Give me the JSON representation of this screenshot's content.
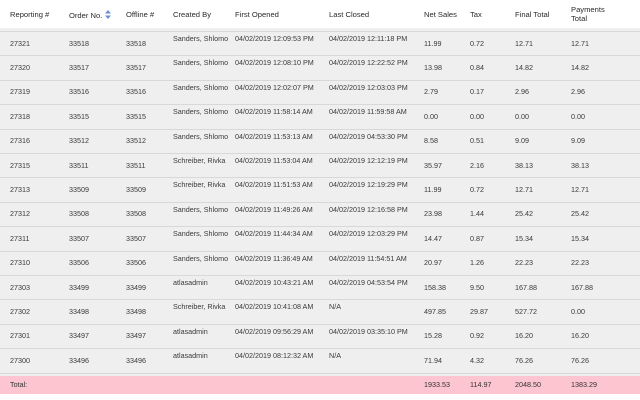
{
  "columns": [
    {
      "key": "rep",
      "label": "Reporting #"
    },
    {
      "key": "order",
      "label": "Order No."
    },
    {
      "key": "offline",
      "label": "Offline #"
    },
    {
      "key": "created",
      "label": "Created By"
    },
    {
      "key": "first",
      "label": "First Opened"
    },
    {
      "key": "last",
      "label": "Last Closed"
    },
    {
      "key": "net",
      "label": "Net Sales"
    },
    {
      "key": "tax",
      "label": "Tax"
    },
    {
      "key": "final",
      "label": "Final Total"
    },
    {
      "key": "pay",
      "label": "Payments Total"
    }
  ],
  "sort_icon": "sort-arrows-icon",
  "rows": [
    {
      "rep": "27321",
      "order": "33518",
      "offline": "33518",
      "created": "Sanders, Shlomo",
      "first": "04/02/2019 12:09:53 PM",
      "last": "04/02/2019 12:11:18 PM",
      "net": "11.99",
      "tax": "0.72",
      "final": "12.71",
      "pay": "12.71"
    },
    {
      "rep": "27320",
      "order": "33517",
      "offline": "33517",
      "created": "Sanders, Shlomo",
      "first": "04/02/2019 12:08:10 PM",
      "last": "04/02/2019 12:22:52 PM",
      "net": "13.98",
      "tax": "0.84",
      "final": "14.82",
      "pay": "14.82"
    },
    {
      "rep": "27319",
      "order": "33516",
      "offline": "33516",
      "created": "Sanders, Shlomo",
      "first": "04/02/2019 12:02:07 PM",
      "last": "04/02/2019 12:03:03 PM",
      "net": "2.79",
      "tax": "0.17",
      "final": "2.96",
      "pay": "2.96"
    },
    {
      "rep": "27318",
      "order": "33515",
      "offline": "33515",
      "created": "Sanders, Shlomo",
      "first": "04/02/2019 11:58:14 AM",
      "last": "04/02/2019 11:59:58 AM",
      "net": "0.00",
      "tax": "0.00",
      "final": "0.00",
      "pay": "0.00"
    },
    {
      "rep": "27316",
      "order": "33512",
      "offline": "33512",
      "created": "Sanders, Shlomo",
      "first": "04/02/2019 11:53:13 AM",
      "last": "04/02/2019 04:53:30 PM",
      "net": "8.58",
      "tax": "0.51",
      "final": "9.09",
      "pay": "9.09"
    },
    {
      "rep": "27315",
      "order": "33511",
      "offline": "33511",
      "created": "Schreiber, Rivka",
      "first": "04/02/2019 11:53:04 AM",
      "last": "04/02/2019 12:12:19 PM",
      "net": "35.97",
      "tax": "2.16",
      "final": "38.13",
      "pay": "38.13"
    },
    {
      "rep": "27313",
      "order": "33509",
      "offline": "33509",
      "created": "Schreiber, Rivka",
      "first": "04/02/2019 11:51:53 AM",
      "last": "04/02/2019 12:19:29 PM",
      "net": "11.99",
      "tax": "0.72",
      "final": "12.71",
      "pay": "12.71"
    },
    {
      "rep": "27312",
      "order": "33508",
      "offline": "33508",
      "created": "Sanders, Shlomo",
      "first": "04/02/2019 11:49:26 AM",
      "last": "04/02/2019 12:16:58 PM",
      "net": "23.98",
      "tax": "1.44",
      "final": "25.42",
      "pay": "25.42"
    },
    {
      "rep": "27311",
      "order": "33507",
      "offline": "33507",
      "created": "Sanders, Shlomo",
      "first": "04/02/2019 11:44:34 AM",
      "last": "04/02/2019 12:03:29 PM",
      "net": "14.47",
      "tax": "0.87",
      "final": "15.34",
      "pay": "15.34"
    },
    {
      "rep": "27310",
      "order": "33506",
      "offline": "33506",
      "created": "Sanders, Shlomo",
      "first": "04/02/2019 11:36:49 AM",
      "last": "04/02/2019 11:54:51 AM",
      "net": "20.97",
      "tax": "1.26",
      "final": "22.23",
      "pay": "22.23"
    },
    {
      "rep": "27303",
      "order": "33499",
      "offline": "33499",
      "created": "atlasadmin",
      "first": "04/02/2019 10:43:21 AM",
      "last": "04/02/2019 04:53:54 PM",
      "net": "158.38",
      "tax": "9.50",
      "final": "167.88",
      "pay": "167.88"
    },
    {
      "rep": "27302",
      "order": "33498",
      "offline": "33498",
      "created": "Schreiber, Rivka",
      "first": "04/02/2019 10:41:08 AM",
      "last": "N/A",
      "net": "497.85",
      "tax": "29.87",
      "final": "527.72",
      "pay": "0.00"
    },
    {
      "rep": "27301",
      "order": "33497",
      "offline": "33497",
      "created": "atlasadmin",
      "first": "04/02/2019 09:56:29 AM",
      "last": "04/02/2019 03:35:10 PM",
      "net": "15.28",
      "tax": "0.92",
      "final": "16.20",
      "pay": "16.20"
    },
    {
      "rep": "27300",
      "order": "33496",
      "offline": "33496",
      "created": "atlasadmin",
      "first": "04/02/2019 08:12:32 AM",
      "last": "N/A",
      "net": "71.94",
      "tax": "4.32",
      "final": "76.26",
      "pay": "76.26"
    }
  ],
  "totals": {
    "label": "Total:",
    "net": "1933.53",
    "tax": "114.97",
    "final": "2048.50",
    "pay": "1383.29"
  },
  "colors": {
    "row_bg": "#efefef",
    "total_bg": "#fcc5cf",
    "sort_icon": "#6a8fcf"
  }
}
